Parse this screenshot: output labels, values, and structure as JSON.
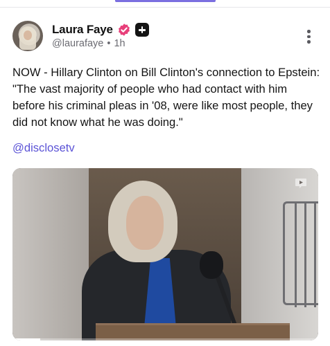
{
  "post": {
    "author": {
      "display_name": "Laura Faye",
      "handle": "@laurafaye",
      "separator": "•",
      "time_ago": "1h"
    },
    "text": "NOW - Hillary Clinton on Bill Clinton's connection to Epstein: \"The vast majority of people who had contact with him before his criminal pleas in '08, were like most people, they did not know what he was doing.\"",
    "mention": "@disclosetv",
    "media": {
      "type": "video",
      "progress": 0.09
    }
  },
  "icons": {
    "verified": "verified-check-icon",
    "badge": "plus-badge-icon",
    "more": "more-vertical-icon",
    "watermark": "play-logo-icon"
  },
  "colors": {
    "accent": "#7b6fe0",
    "link": "#5b53d6",
    "verified": "#e83f7a"
  }
}
